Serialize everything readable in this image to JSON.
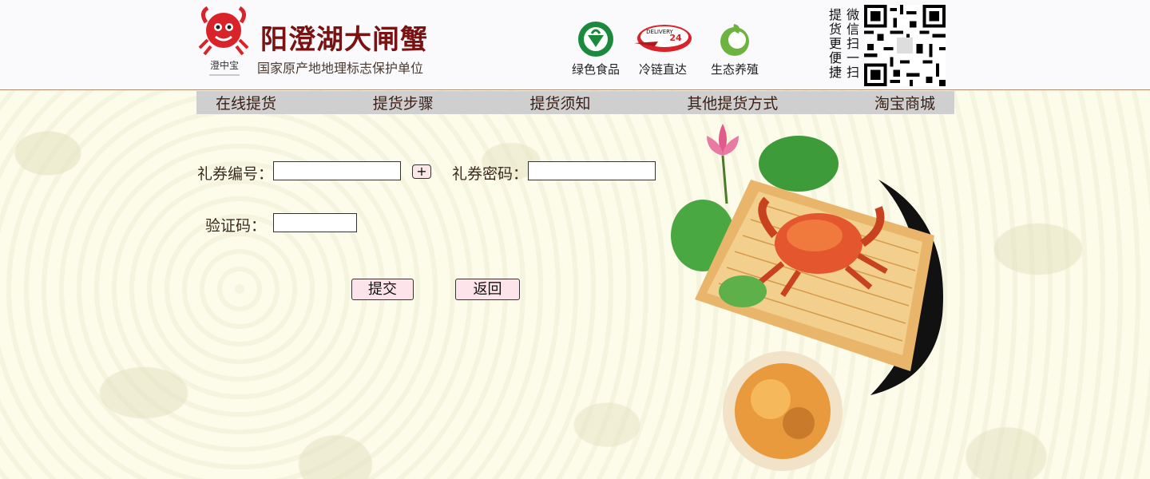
{
  "header": {
    "brand_title": "阳澄湖大闸蟹",
    "brand_subtitle": "国家原产地地理标志保护单位",
    "logo_text": "澄中宝",
    "badges": [
      {
        "label": "绿色食品",
        "icon": "green-food-icon"
      },
      {
        "label": "冷链直达",
        "icon": "delivery-icon"
      },
      {
        "label": "生态养殖",
        "icon": "eco-icon"
      }
    ],
    "qr_caption_col1": "微信扫一扫",
    "qr_caption_col2": "提货更便捷",
    "delivery_badge_text": "DELIVERY",
    "delivery_badge_num": "24"
  },
  "nav": {
    "items": [
      "在线提货",
      "提货步骤",
      "提货须知",
      "其他提货方式",
      "淘宝商城"
    ]
  },
  "form": {
    "coupon_number_label": "礼券编号：",
    "coupon_number_value": "",
    "add_button": "+",
    "coupon_password_label": "礼券密码：",
    "coupon_password_value": "",
    "captcha_label": "验证码：",
    "captcha_value": "",
    "submit_label": "提交",
    "back_label": "返回"
  },
  "colors": {
    "brand": "#7a1212",
    "nav_bg": "#cfcfcf",
    "button_bg": "#fde3ea",
    "page_bg": "#fdfbe9"
  }
}
